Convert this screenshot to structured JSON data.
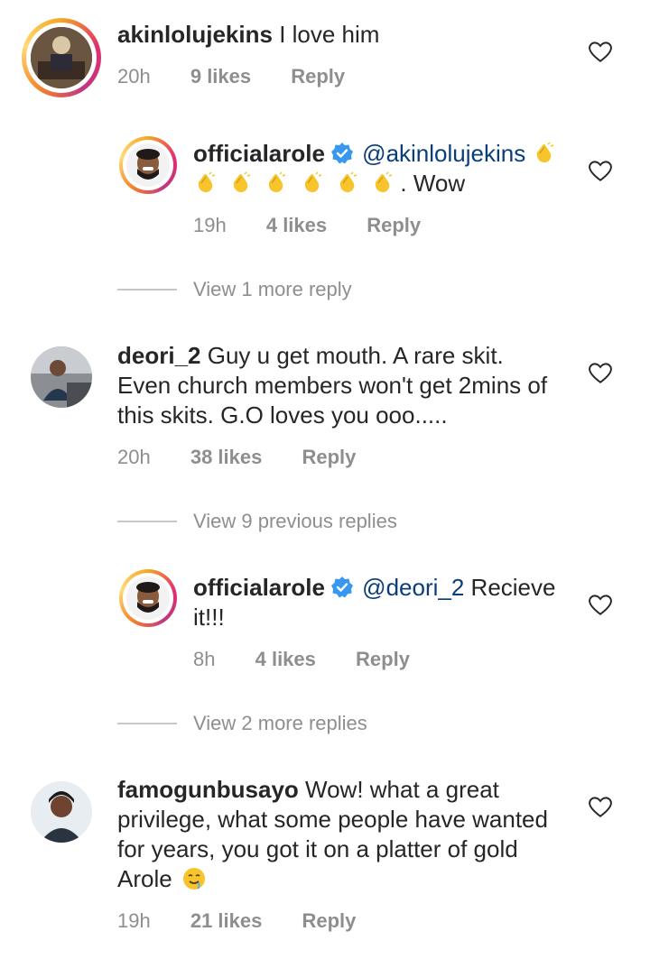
{
  "comments": [
    {
      "username": "akinlolujekins",
      "text": "I love him",
      "time": "20h",
      "likes": "9 likes",
      "reply": "Reply"
    },
    {
      "username": "officialarole",
      "mention": "@akinlolujekins",
      "text_after": ". Wow",
      "time": "19h",
      "likes": "4 likes",
      "reply": "Reply"
    },
    {
      "view_more": "View 1 more reply"
    },
    {
      "username": "deori_2",
      "text_line1": "Guy u get mouth. A rare skit.",
      "text_line2": "Even church members won't get 2mins of",
      "text_line3": "this skits. G.O loves you ooo.....",
      "time": "20h",
      "likes": "38 likes",
      "reply": "Reply"
    },
    {
      "view_more": "View 9 previous replies"
    },
    {
      "username": "officialarole",
      "mention": "@deori_2",
      "text_line1": "Recieve",
      "text_line2": "it!!!",
      "time": "8h",
      "likes": "4 likes",
      "reply": "Reply"
    },
    {
      "view_more": "View 2 more replies"
    },
    {
      "username": "famogunbusayo",
      "text_line1": "Wow! what a great",
      "text_line2": "privilege, what some people have wanted",
      "text_line3": "for years, you got it on a platter of gold",
      "text_line4": "Arole",
      "time": "19h",
      "likes": "21 likes",
      "reply": "Reply"
    }
  ],
  "colors": {
    "text": "#262626",
    "meta": "#8e8e8e",
    "mention": "#0a3e7a",
    "verified": "#3897f0"
  },
  "icons": [
    "heart-outline-icon",
    "verified-badge-icon",
    "clapping-hands-emoji",
    "drooling-face-emoji"
  ]
}
